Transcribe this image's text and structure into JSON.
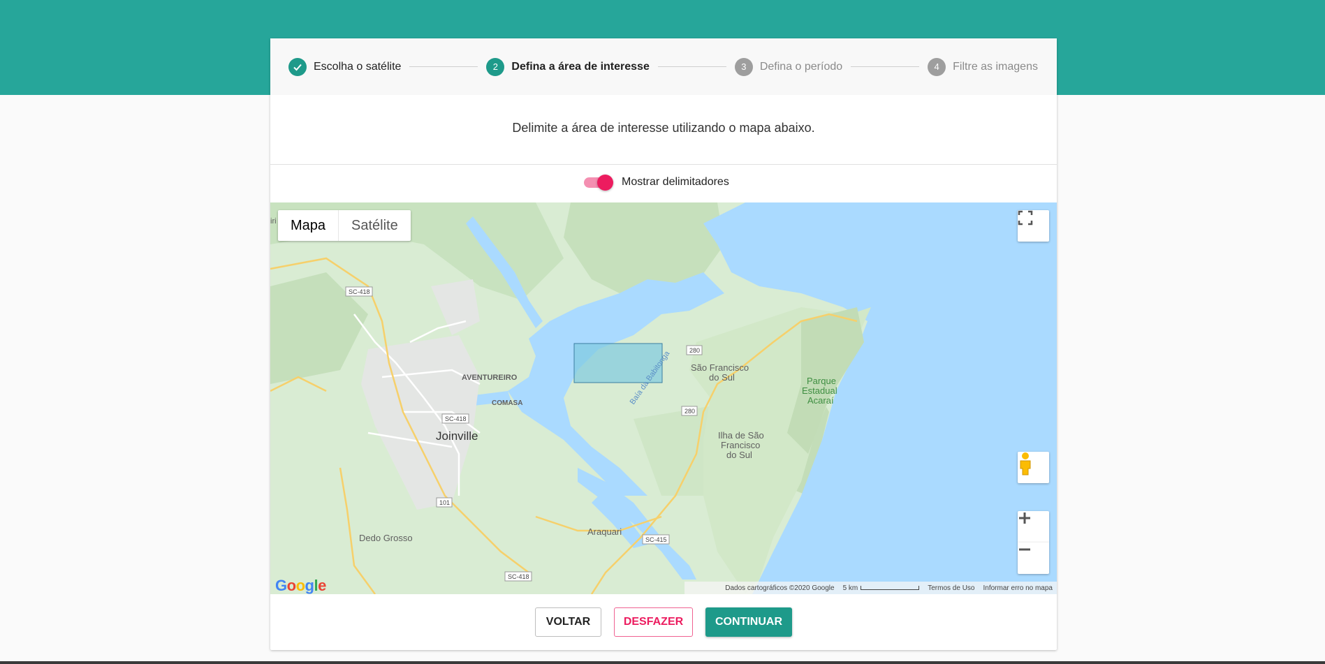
{
  "stepper": {
    "steps": [
      {
        "num": "",
        "label": "Escolha o satélite",
        "state": "done"
      },
      {
        "num": "2",
        "label": "Defina a área de interesse",
        "state": "active"
      },
      {
        "num": "3",
        "label": "Defina o período",
        "state": "inactive"
      },
      {
        "num": "4",
        "label": "Filtre as imagens",
        "state": "inactive"
      }
    ]
  },
  "instruction": "Delimite a área de interesse utilizando o mapa abaixo.",
  "toggle": {
    "label": "Mostrar delimitadores",
    "on": true
  },
  "map": {
    "type_buttons": {
      "map": "Mapa",
      "satellite": "Satélite"
    },
    "labels": {
      "aventureiro": "AVENTUREIRO",
      "comasa": "COMASA",
      "joinville": "Joinville",
      "dedo_grosso": "Dedo Grosso",
      "araquari": "Araquari",
      "sao_francisco": "São Francisco",
      "do_sul": "do Sul",
      "parque": "Parque",
      "estadual": "Estadual",
      "acarai": "Acaraí",
      "ilha": "Ilha de São",
      "francisco": "Francisco",
      "do_sul_2": "do Sul",
      "baia": "Baía da Babitonga",
      "edge": "iri"
    },
    "shields": {
      "sc418a": "SC-418",
      "sc418b": "SC-418",
      "sc418c": "SC-418",
      "r280a": "280",
      "r280b": "280",
      "r101": "101",
      "sc415": "SC-415"
    },
    "attribution": {
      "data": "Dados cartográficos ©2020 Google",
      "scale": "5 km",
      "terms": "Termos de Uso",
      "report": "Informar erro no mapa"
    },
    "logo": "Google"
  },
  "actions": {
    "back": "VOLTAR",
    "undo": "DESFAZER",
    "next": "CONTINUAR"
  },
  "colors": {
    "primary": "#26a69a",
    "accent": "#ec1c5f",
    "water": "#aadaff",
    "land": "#d9ecd3"
  }
}
